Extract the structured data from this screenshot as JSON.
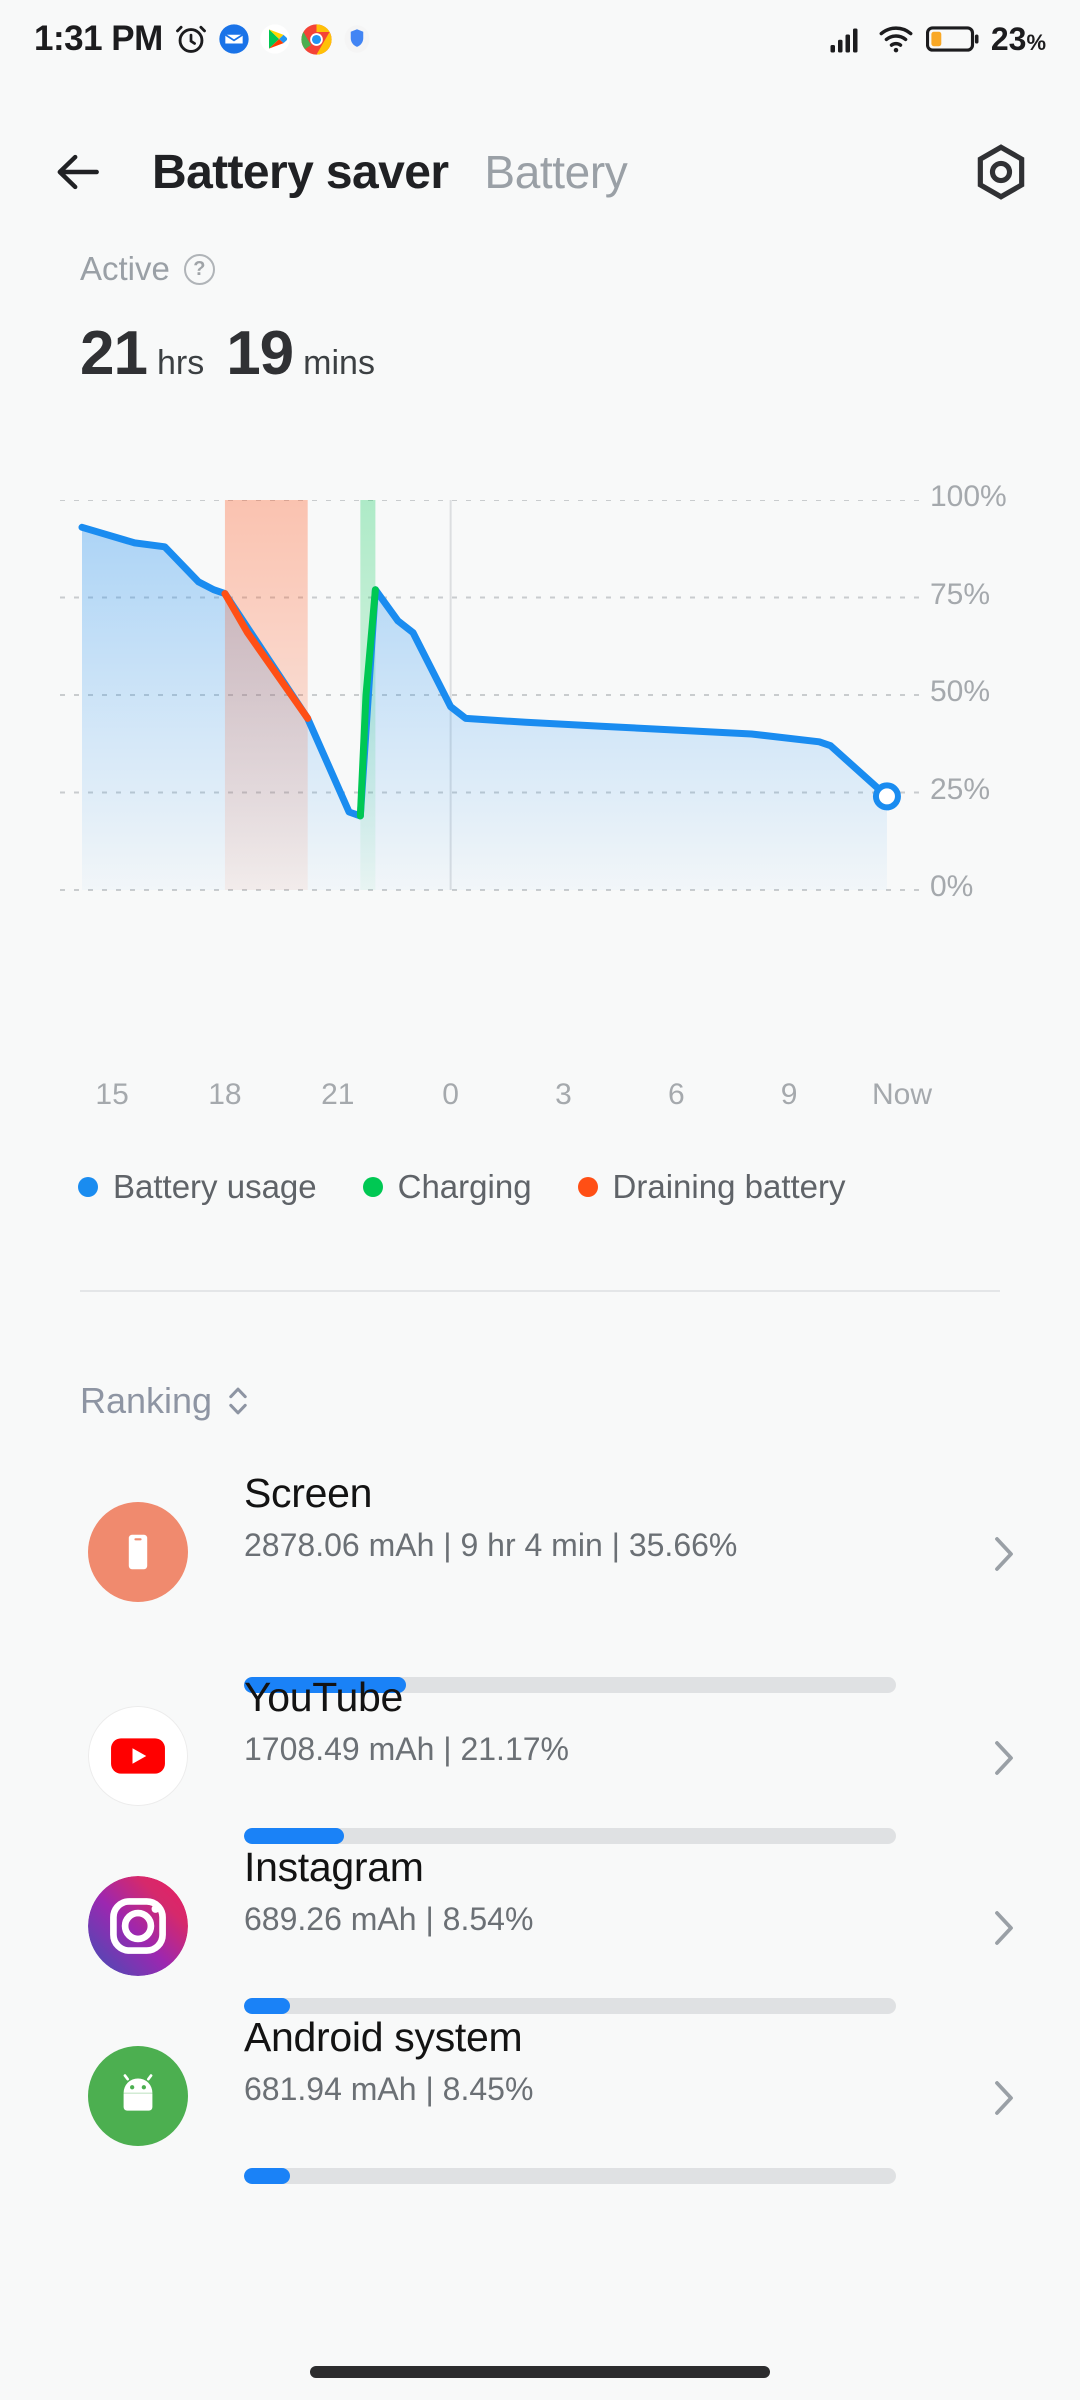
{
  "status_bar": {
    "time": "1:31 PM",
    "left_icons": [
      "alarm-icon",
      "gmail-icon",
      "play-store-icon",
      "chrome-icon",
      "security-shield-icon"
    ],
    "signal_icon": "cellular-signal-icon",
    "wifi_icon": "wifi-icon",
    "battery_icon": "battery-low-icon",
    "battery_percent": "23",
    "battery_percent_unit": "%"
  },
  "header": {
    "back_icon": "back-arrow-icon",
    "title": "Battery saver",
    "alt_tab": "Battery",
    "settings_icon": "settings-hex-icon"
  },
  "summary": {
    "status_label": "Active",
    "help_icon": "help-question-icon",
    "hours_value": "21",
    "hours_unit": "hrs",
    "mins_value": "19",
    "mins_unit": "mins"
  },
  "colors": {
    "usage_blue": "#1a8cf0",
    "charging_green": "#00c853",
    "draining_orange": "#ff4f15",
    "progress_blue": "#1a82f7",
    "track_gray": "#dfe1e3",
    "background": "#f8f9f9"
  },
  "chart_data": {
    "type": "line",
    "title": "",
    "xlabel": "",
    "ylabel": "",
    "ylim": [
      0,
      100
    ],
    "grid": true,
    "legend_position": "below",
    "y_ticks": [
      "100%",
      "75%",
      "50%",
      "25%",
      "0%"
    ],
    "y_tick_values": [
      100,
      75,
      50,
      25,
      0
    ],
    "x_ticks": [
      "15",
      "18",
      "21",
      "0",
      "3",
      "6",
      "9",
      "Now"
    ],
    "x_tick_values": [
      15,
      18,
      21,
      24,
      27,
      30,
      33,
      36
    ],
    "series": [
      {
        "name": "Battery usage",
        "color": "#1a8cf0",
        "points": [
          [
            14.2,
            93
          ],
          [
            15.6,
            89
          ],
          [
            16.4,
            88
          ],
          [
            17.3,
            79
          ],
          [
            17.7,
            77
          ],
          [
            18.0,
            76
          ],
          [
            20.2,
            44
          ],
          [
            21.3,
            20
          ],
          [
            21.6,
            19
          ],
          [
            22.0,
            77
          ],
          [
            22.6,
            69
          ],
          [
            23.0,
            66
          ],
          [
            24.0,
            47
          ],
          [
            24.4,
            44
          ],
          [
            26.0,
            43
          ],
          [
            28.0,
            42
          ],
          [
            30.0,
            41
          ],
          [
            32.0,
            40
          ],
          [
            33.8,
            38
          ],
          [
            34.1,
            37
          ],
          [
            35.6,
            24
          ]
        ]
      },
      {
        "name": "Charging",
        "color": "#00c853",
        "points": [
          [
            21.6,
            19
          ],
          [
            21.75,
            50
          ],
          [
            22.0,
            77
          ]
        ]
      },
      {
        "name": "Draining battery",
        "color": "#ff4f15",
        "points": [
          [
            18.0,
            76
          ],
          [
            18.6,
            66
          ],
          [
            20.2,
            44
          ]
        ]
      }
    ],
    "current_point": {
      "x": 35.6,
      "y": 24,
      "marker": "hollow-circle"
    },
    "bands": [
      {
        "type": "draining",
        "color": "#ff4f15",
        "x_start": 18.0,
        "x_end": 20.2
      },
      {
        "type": "charging",
        "color": "#00c853",
        "x_start": 21.6,
        "x_end": 22.0
      }
    ]
  },
  "legend": [
    {
      "label": "Battery usage",
      "color": "#1a8cf0"
    },
    {
      "label": "Charging",
      "color": "#00c853"
    },
    {
      "label": "Draining battery",
      "color": "#ff4f15"
    }
  ],
  "ranking": {
    "label": "Ranking",
    "sort_icon": "sort-updown-icon"
  },
  "apps": [
    {
      "name": "Screen",
      "meta": "2878.06 mAh | 9 hr 4 min  |  35.66%",
      "mah": "2878.06",
      "duration": "9 hr 4 min",
      "percent": "35.66%",
      "percent_value": 35.66,
      "icon": "screen-phone-icon",
      "icon_bg": "#f08a6e",
      "chevron": "chevron-right-icon"
    },
    {
      "name": "YouTube",
      "meta": "1708.49 mAh | 21.17%",
      "mah": "1708.49",
      "duration": "",
      "percent": "21.17%",
      "percent_value": 21.17,
      "icon": "youtube-icon",
      "icon_bg": "#ffffff",
      "chevron": "chevron-right-icon"
    },
    {
      "name": "Instagram",
      "meta": "689.26 mAh | 8.54%",
      "mah": "689.26",
      "duration": "",
      "percent": "8.54%",
      "percent_value": 8.54,
      "icon": "instagram-icon",
      "icon_bg": "#c13584",
      "chevron": "chevron-right-icon"
    },
    {
      "name": "Android system",
      "meta": "681.94 mAh | 8.45%",
      "mah": "681.94",
      "duration": "",
      "percent": "8.45%",
      "percent_value": 8.45,
      "icon": "android-robot-icon",
      "icon_bg": "#4caf50",
      "chevron": "chevron-right-icon"
    }
  ]
}
